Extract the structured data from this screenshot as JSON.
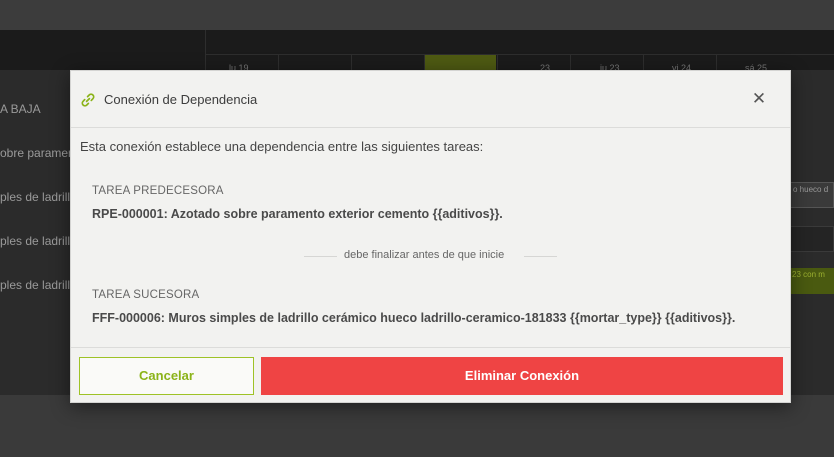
{
  "background": {
    "left_rows": [
      "A BAJA",
      "obre paramen",
      "ples de ladrill",
      "ples de ladrill",
      "ples de ladrill"
    ],
    "day_labels": [
      "lu 19",
      "23",
      "ju 23",
      "vi 24",
      "sá 25"
    ],
    "right_bars": [
      "o hueco d",
      "",
      "23 con m"
    ]
  },
  "modal": {
    "title": "Conexión de Dependencia",
    "close_symbol": "✕",
    "intro": "Esta conexión establece una dependencia entre las siguientes tareas:",
    "predecessor": {
      "label": "TAREA PREDECESORA",
      "task": "RPE-000001: Azotado sobre paramento exterior cemento {{aditivos}}."
    },
    "separator_text": "debe finalizar antes de que inicie",
    "successor": {
      "label": "TAREA SUCESORA",
      "task": "FFF-000006: Muros simples de ladrillo cerámico hueco ladrillo-ceramico-181833 {{mortar_type}} {{aditivos}}."
    },
    "buttons": {
      "cancel": "Cancelar",
      "delete": "Eliminar Conexión"
    },
    "icons": {
      "title_icon": "link-icon",
      "close_icon": "close-icon"
    }
  },
  "colors": {
    "accent_green": "#8bb319",
    "danger_red": "#ef4444"
  }
}
